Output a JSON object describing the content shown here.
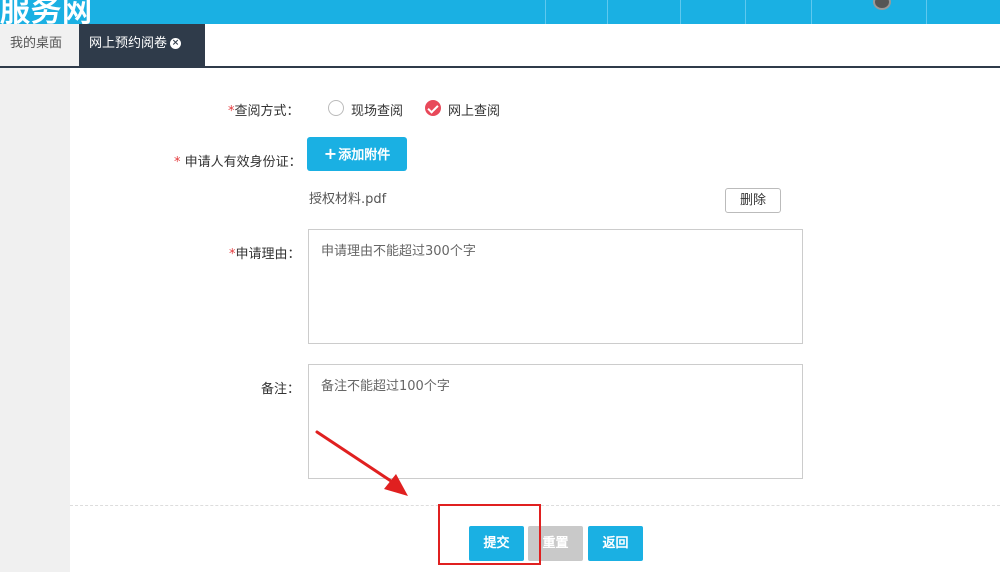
{
  "app": {
    "brand": "服务网"
  },
  "tabs": [
    {
      "label": "我的桌面"
    },
    {
      "label": "网上预约阅卷",
      "close_icon": "×"
    }
  ],
  "form": {
    "query_method": {
      "label_req": "*",
      "label": "查阅方式：",
      "options": [
        {
          "label": "现场查阅",
          "checked": false
        },
        {
          "label": "网上查阅",
          "checked": true
        }
      ]
    },
    "id_doc": {
      "label_req": "* ",
      "label": "申请人有效身份证：",
      "add_button_icon": "+",
      "add_button": "添加附件",
      "file_name": "授权材料.pdf",
      "delete_button": "删除"
    },
    "reason": {
      "label_req": "*",
      "label": "申请理由：",
      "placeholder": "申请理由不能超过300个字"
    },
    "remark": {
      "label": "备注：",
      "placeholder": "备注不能超过100个字"
    }
  },
  "actions": {
    "submit": "提交",
    "reset": "重置",
    "back": "返回"
  },
  "colors": {
    "primary": "#1ab0e3",
    "tab_active_bg": "#2f3b4a",
    "required": "#e4393c",
    "checked": "#e8495a",
    "annotation": "#e02020"
  }
}
